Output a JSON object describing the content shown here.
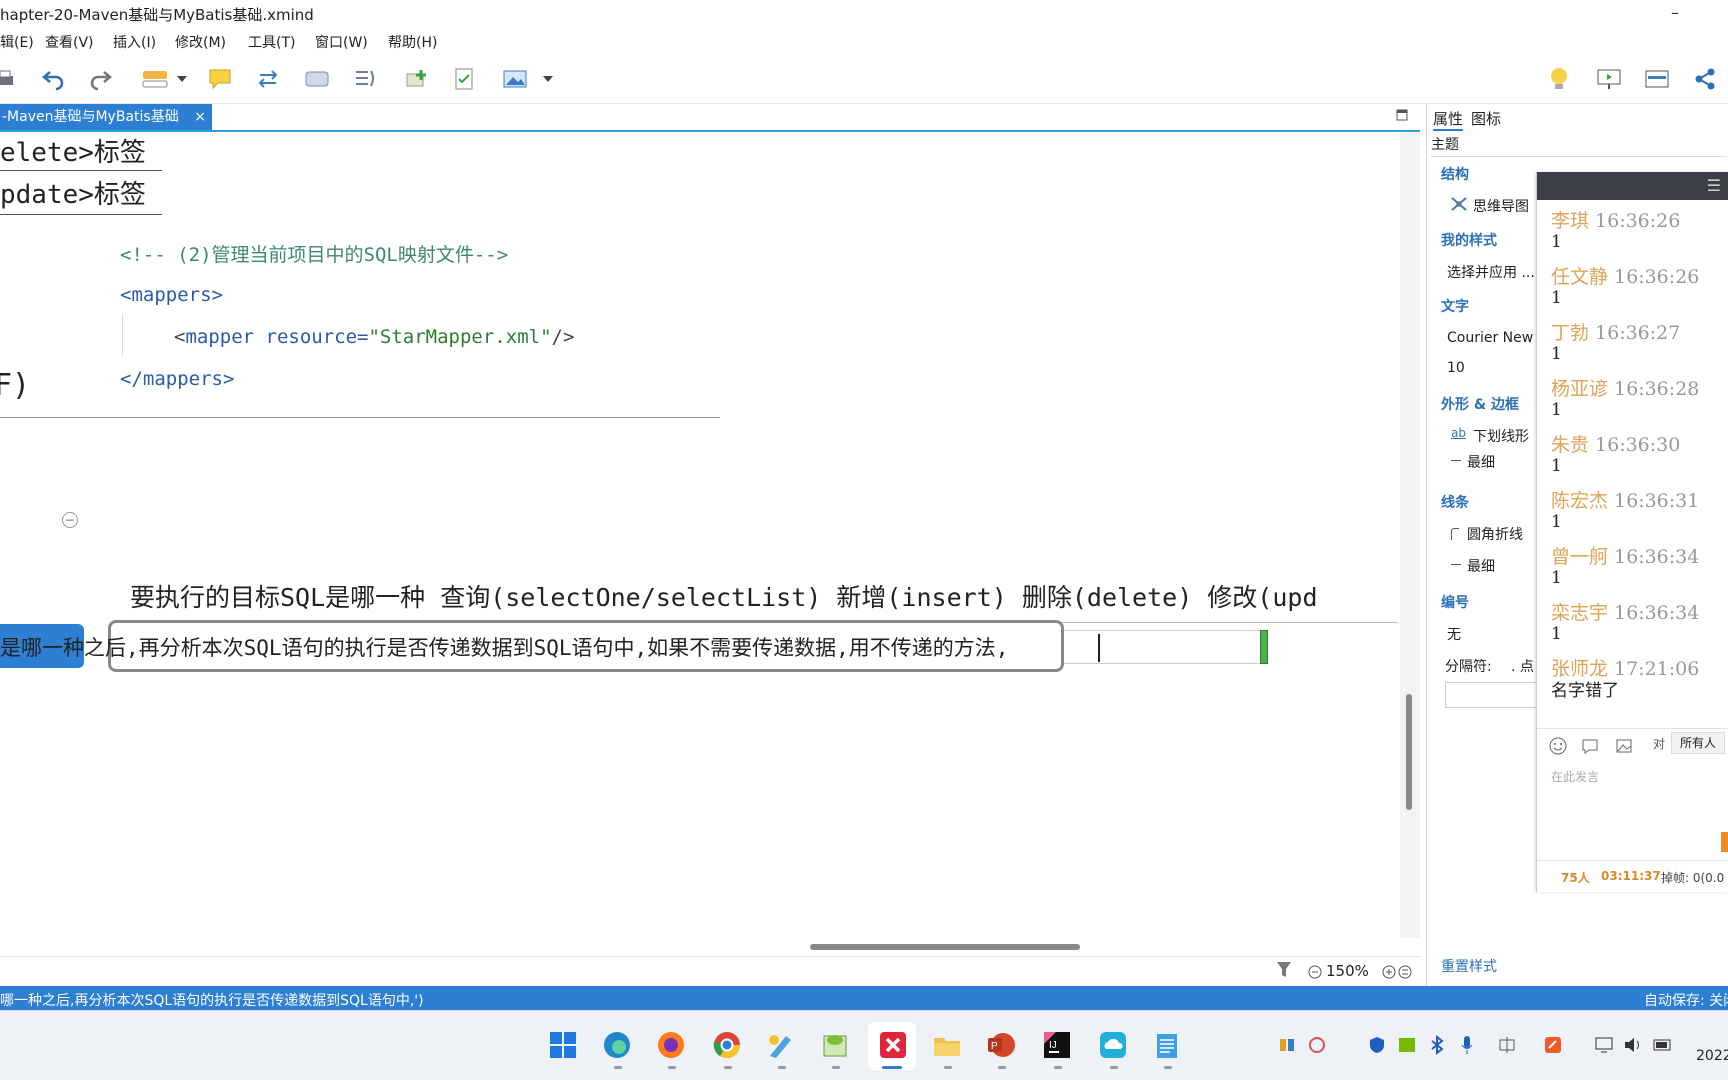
{
  "window": {
    "title": "hapter-20-Maven基础与MyBatis基础.xmind",
    "minimize_glyph": "–"
  },
  "menu": [
    "辑(E)",
    "查看(V)",
    "插入(I)",
    "修改(M)",
    "工具(T)",
    "窗口(W)",
    "帮助(H)"
  ],
  "toolbar": {
    "icons": [
      "print-icon",
      "undo-icon",
      "redo-icon",
      "topic-icon",
      "dropdown-icon",
      "callout-icon",
      "relationship-icon",
      "boundary-icon",
      "summary-icon",
      "add-topic-icon",
      "task-icon",
      "image-icon",
      "dropdown-icon",
      "idea-icon",
      "presentation-icon",
      "panel-icon",
      "share-icon"
    ]
  },
  "tab": {
    "label": "-Maven基础与MyBatis基础",
    "close": "×"
  },
  "canvas": {
    "label_delete": "elete>标签",
    "label_update": "pdate>标签",
    "label_partial": "F)",
    "code_lines": [
      {
        "kind": "comment",
        "text": "<!-- (2)管理当前项目中的SQL映射文件-->"
      },
      {
        "kind": "tag",
        "text": "<mappers>"
      },
      {
        "kind": "mapper",
        "open": "<",
        "tag": "mapper",
        "attr": " resource=",
        "value": "\"StarMapper.xml\"",
        "close": "/>"
      },
      {
        "kind": "tag",
        "text": "</mappers>"
      }
    ],
    "target_sql": "要执行的目标SQL是哪一种 查询(selectOne/selectList)  新增(insert) 删除(delete) 修改(upd",
    "edit_text": "是哪一种之后,再分析本次SQL语句的执行是否传递数据到SQL语句中,如果不需要传递数据,用不传递的方法,",
    "collapse_glyph": "−"
  },
  "zoom": {
    "value": "150%"
  },
  "statusbar": {
    "left": "哪一种之后,再分析本次SQL语句的执行是否传递数据到SQL语句中,')",
    "right": "自动保存: 关闭"
  },
  "properties": {
    "tabs": [
      "属性",
      "图标"
    ],
    "subject": "主题",
    "structure_title": "结构",
    "structure_value": "思维导图",
    "mystyle_title": "我的样式",
    "mystyle_value": "选择并应用 ...",
    "text_title": "文字",
    "font_value": "Courier New",
    "font_size": "10",
    "shape_title": "外形 & 边框",
    "shape_value": "下划线形",
    "shape_border": "最细",
    "line_title": "线条",
    "line_value": "圆角折线",
    "line_width": "最细",
    "number_title": "编号",
    "number_value": "无",
    "separator_label": "分隔符:",
    "separator_value": ". 点",
    "reset": "重置样式"
  },
  "chat": {
    "messages": [
      {
        "name": "李琪",
        "time": "16:36:26",
        "body": "1"
      },
      {
        "name": "任文静",
        "time": "16:36:26",
        "body": "1"
      },
      {
        "name": "丁勃",
        "time": "16:36:27",
        "body": "1"
      },
      {
        "name": "杨亚谚",
        "time": "16:36:28",
        "body": "1"
      },
      {
        "name": "朱贵",
        "time": "16:36:30",
        "body": "1"
      },
      {
        "name": "陈宏杰",
        "time": "16:36:31",
        "body": "1"
      },
      {
        "name": "曾一舸",
        "time": "16:36:34",
        "body": "1"
      },
      {
        "name": "栾志宇",
        "time": "16:36:34",
        "body": "1"
      },
      {
        "name": "张师龙",
        "time": "17:21:06",
        "body": "名字错了"
      }
    ],
    "to_label": "对",
    "to_value": "所有人",
    "placeholder": "在此发言",
    "count": "75人",
    "duration": "03:11:37",
    "dropped_frames": "掉帧: 0(0.0"
  },
  "taskbar": {
    "clock": "2022"
  }
}
